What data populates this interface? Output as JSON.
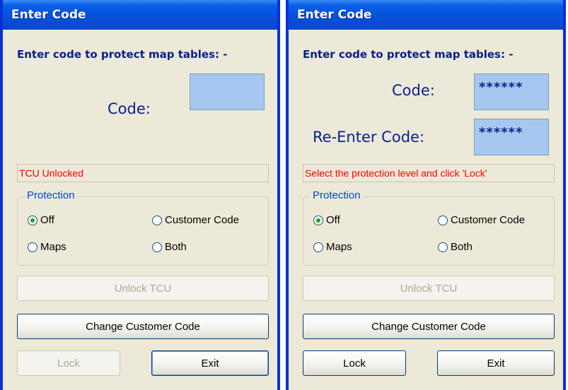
{
  "left": {
    "title": "Enter Code",
    "heading": "Enter code to protect map tables: -",
    "code_label": "Code:",
    "code_value": "",
    "status": "TCU Unlocked",
    "protection_title": "Protection",
    "options": {
      "off": "Off",
      "customer_code": "Customer Code",
      "maps": "Maps",
      "both": "Both"
    },
    "unlock_label": "Unlock TCU",
    "change_label": "Change Customer Code",
    "lock_label": "Lock",
    "exit_label": "Exit"
  },
  "right": {
    "title": "Enter Code",
    "heading": "Enter code to protect map tables: -",
    "code_label": "Code:",
    "code_value": "******",
    "reenter_label": "Re-Enter Code:",
    "reenter_value": "******",
    "status": "Select the protection level and click 'Lock'",
    "protection_title": "Protection",
    "options": {
      "off": "Off",
      "customer_code": "Customer Code",
      "maps": "Maps",
      "both": "Both"
    },
    "unlock_label": "Unlock TCU",
    "change_label": "Change Customer Code",
    "lock_label": "Lock",
    "exit_label": "Exit"
  },
  "colors": {
    "title_blue": "#0a5ee8",
    "status_red": "#ff0000",
    "heading_blue": "#0a1f8c",
    "input_blue": "#a6c8f0"
  }
}
